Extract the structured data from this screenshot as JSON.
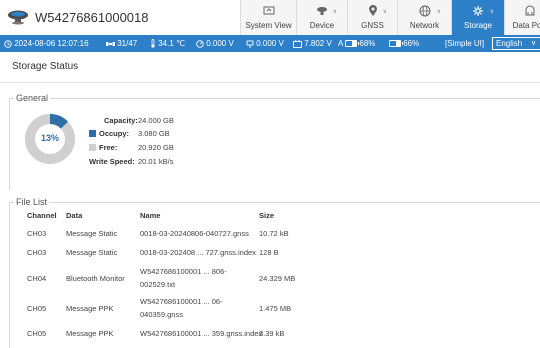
{
  "header": {
    "device_id": "W54276861000018",
    "nav": [
      {
        "label": "System View",
        "icon": "system-view-icon",
        "active": false,
        "dropdown": false
      },
      {
        "label": "Device",
        "icon": "device-icon",
        "active": false,
        "dropdown": true
      },
      {
        "label": "GNSS",
        "icon": "gnss-icon",
        "active": false,
        "dropdown": true
      },
      {
        "label": "Network",
        "icon": "network-icon",
        "active": false,
        "dropdown": true
      },
      {
        "label": "Storage",
        "icon": "storage-icon",
        "active": true,
        "dropdown": true
      },
      {
        "label": "Data Port",
        "icon": "data-port-icon",
        "active": false,
        "dropdown": false
      }
    ]
  },
  "status_bar": {
    "datetime": "2024-08-06 12:07:16",
    "satellites": "31/47",
    "temperature": "34.1 ℃",
    "voltage": "0.000 V",
    "power_voltage": "0.000 V",
    "battery_voltage": "7.802 V",
    "battery_a_label": "A",
    "battery_a": "68%",
    "battery_b": "66%",
    "mode_link": "[Simple UI]",
    "language": "English"
  },
  "colors": {
    "accent": "#2d7fc8",
    "occupy": "#2f6fa8",
    "free": "#d0d0d0"
  },
  "storage": {
    "title": "Storage Status",
    "general_legend": "General",
    "used_percent_label": "13%",
    "used_fraction": 0.128,
    "capacity_label": "Capacity:",
    "capacity": "24.000 GB",
    "occupy_label": "Occupy:",
    "occupy": "3.080 GB",
    "free_label": "Free:",
    "free": "20.920 GB",
    "write_speed_label": "Write Speed:",
    "write_speed": "20.01 kB/s"
  },
  "file_list": {
    "legend": "File List",
    "columns": {
      "channel": "Channel",
      "data": "Data",
      "name": "Name",
      "size": "Size"
    },
    "rows": [
      {
        "channel": "CH03",
        "data": "Message Static",
        "name": "0018-03-20240806-040727.gnss",
        "size": "10.72 kB"
      },
      {
        "channel": "CH03",
        "data": "Message Static",
        "name": "0018-03-202408 ... 727.gnss.index",
        "size": "128 B"
      },
      {
        "channel": "CH04",
        "data": "Bluetooth Monitor",
        "name": "W5427686100001 ... 806-002529.txt",
        "size": "24.329 MB"
      },
      {
        "channel": "CH05",
        "data": "Message PPK",
        "name": "W5427686100001 ... 06-040359.gnss",
        "size": "1.475 MB"
      },
      {
        "channel": "CH05",
        "data": "Message PPK",
        "name": "W5427686100001 ... 359.gnss.index",
        "size": "3.39 kB"
      }
    ]
  }
}
